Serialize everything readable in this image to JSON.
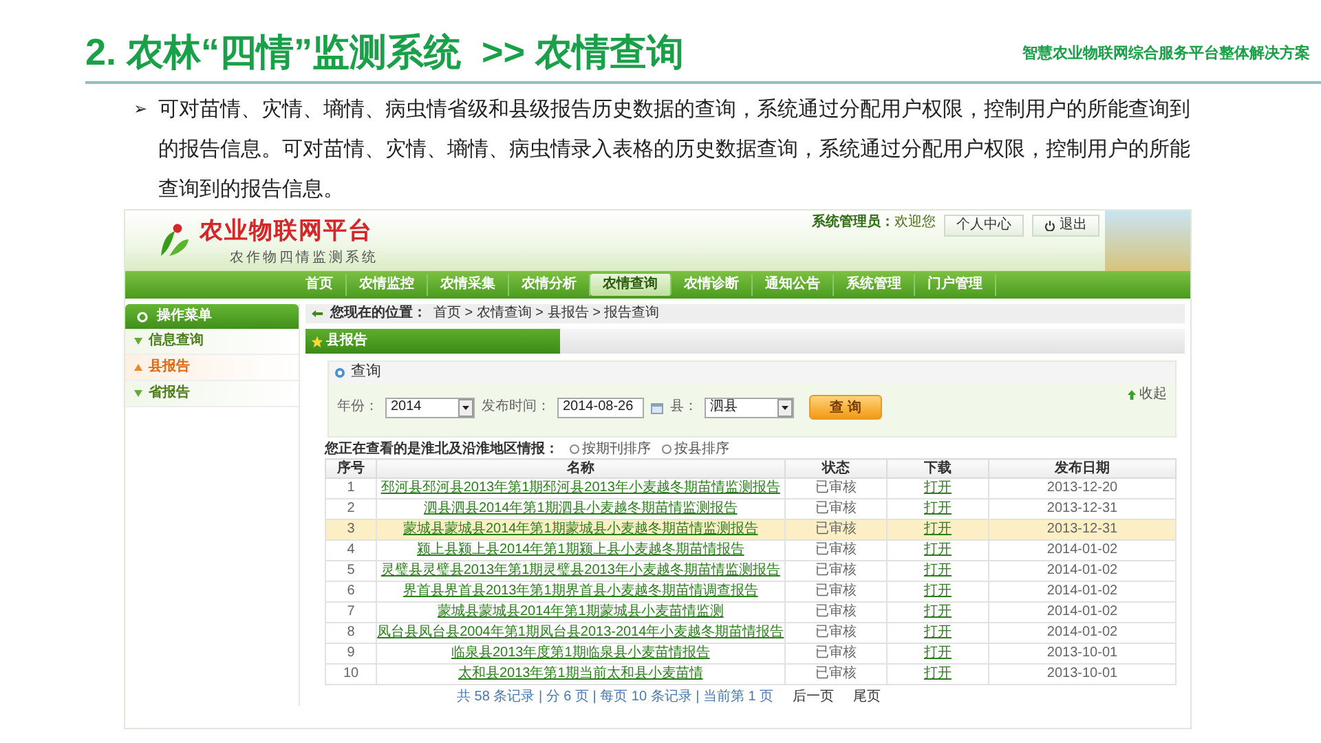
{
  "slide": {
    "title": "2. 农林“四情”监测系统  >> 农情查询",
    "subtitle": "智慧农业物联网综合服务平台整体解决方案",
    "bullet": "➢",
    "paragraph": "可对苗情、灾情、墒情、病虫情省级和县级报告历史数据的查询，系统通过分配用户权限，控制用户的所能查询到的报告信息。可对苗情、灾情、墒情、病虫情录入表格的历史数据查询，系统通过分配用户权限，控制用户的所能查询到的报告信息。"
  },
  "app": {
    "logo_title": "农业物联网平台",
    "logo_subtitle": "农作物四情监测系统",
    "greeting": "**系统管理员：**欢迎您",
    "links": [
      "个人中心",
      "退出"
    ],
    "nav": [
      {
        "label": "首页",
        "selected": false
      },
      {
        "label": "农情监控",
        "selected": false
      },
      {
        "label": "农情采集",
        "selected": false
      },
      {
        "label": "农情分析",
        "selected": false
      },
      {
        "label": "农情查询",
        "selected": true
      },
      {
        "label": "农情诊断",
        "selected": false
      },
      {
        "label": "通知公告",
        "selected": false
      },
      {
        "label": "系统管理",
        "selected": false
      },
      {
        "label": "门户管理",
        "selected": false
      }
    ],
    "sidebar": {
      "title": "操作菜单",
      "items": [
        {
          "label": "信息查询",
          "selected": false
        },
        {
          "label": "县报告",
          "selected": true
        },
        {
          "label": "省报告",
          "selected": false
        }
      ]
    },
    "breadcrumb": {
      "label": "您现在的位置：",
      "path": "首页 > 农情查询 > 县报告 > 报告查询"
    },
    "tab": "县报告",
    "query": {
      "title": "查询",
      "collapse": "收起",
      "fields": [
        {
          "label": "年份：",
          "value": "2014",
          "kind": "select"
        },
        {
          "label": "发布时间：",
          "value": "2014-08-26",
          "kind": "date"
        },
        {
          "label": "县：",
          "value": "泗县",
          "kind": "select"
        }
      ],
      "button": "查 询"
    },
    "table": {
      "caption": "您正在查看的是淮北及沿淮地区情报：",
      "sort_options": [
        {
          "label": "按期刊排序",
          "selected": false
        },
        {
          "label": "按县排序",
          "selected": false
        }
      ],
      "columns": [
        {
          "label": "序号",
          "kind": "text"
        },
        {
          "label": "名称",
          "kind": "link"
        },
        {
          "label": "状态",
          "kind": "text"
        },
        {
          "label": "下载",
          "kind": "link"
        },
        {
          "label": "发布日期",
          "kind": "date"
        }
      ],
      "rows": [
        {
          "cells": [
            "1",
            "邳河县邳河县2013年第1期邳河县2013年小麦越冬期苗情监测报告",
            "已审核",
            "打开",
            "2013-12-20"
          ],
          "selected": false
        },
        {
          "cells": [
            "2",
            "泗县泗县2014年第1期泗县小麦越冬期苗情监测报告",
            "已审核",
            "打开",
            "2013-12-31"
          ],
          "selected": false
        },
        {
          "cells": [
            "3",
            "蒙城县蒙城县2014年第1期蒙城县小麦越冬期苗情监测报告",
            "已审核",
            "打开",
            "2013-12-31"
          ],
          "selected": true
        },
        {
          "cells": [
            "4",
            "颍上县颍上县2014年第1期颍上县小麦越冬期苗情报告",
            "已审核",
            "打开",
            "2014-01-02"
          ],
          "selected": false
        },
        {
          "cells": [
            "5",
            "灵璧县灵璧县2013年第1期灵璧县2013年小麦越冬期苗情监测报告",
            "已审核",
            "打开",
            "2014-01-02"
          ],
          "selected": false
        },
        {
          "cells": [
            "6",
            "界首县界首县2013年第1期界首县小麦越冬期苗情调查报告",
            "已审核",
            "打开",
            "2014-01-02"
          ],
          "selected": false
        },
        {
          "cells": [
            "7",
            "蒙城县蒙城县2014年第1期蒙城县小麦苗情监测",
            "已审核",
            "打开",
            "2014-01-02"
          ],
          "selected": false
        },
        {
          "cells": [
            "8",
            "凤台县凤台县2004年第1期凤台县2013-2014年小麦越冬期苗情报告",
            "已审核",
            "打开",
            "2014-01-02"
          ],
          "selected": false
        },
        {
          "cells": [
            "9",
            "临泉县2013年度第1期临泉县小麦苗情报告",
            "已审核",
            "打开",
            "2013-10-01"
          ],
          "selected": false
        },
        {
          "cells": [
            "10",
            "太和县2013年第1期当前太和县小麦苗情",
            "已审核",
            "打开",
            "2013-10-01"
          ],
          "selected": false
        }
      ]
    },
    "pagination": {
      "summary": "共 58 条记录 | 分 6 页 | 每页 10 条记录 | 当前第 1 页",
      "links": [
        "后一页",
        "尾页"
      ]
    }
  }
}
